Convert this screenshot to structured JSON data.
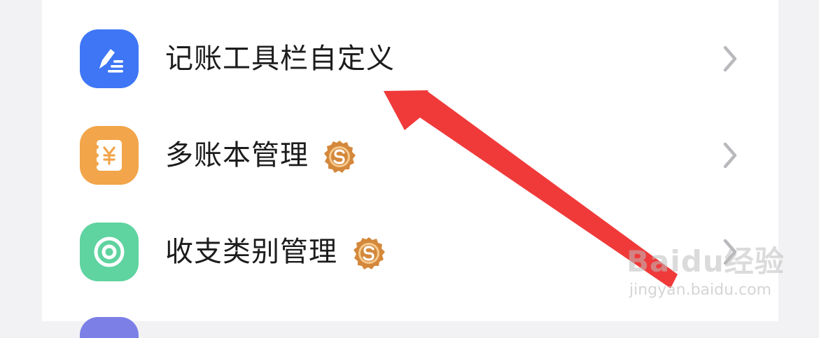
{
  "menu": {
    "items": [
      {
        "label": "记账工具栏自定义",
        "icon": "pen-list-icon",
        "color": "#3e76f5",
        "coin_badge": false
      },
      {
        "label": "多账本管理",
        "icon": "yuan-ledger-icon",
        "color": "#f2a54a",
        "coin_badge": true
      },
      {
        "label": "收支类别管理",
        "icon": "target-icon",
        "color": "#5fd3a0",
        "coin_badge": true
      }
    ],
    "chevron_icon": "chevron-right-icon",
    "badge_icon": "coin-badge-icon"
  },
  "colors": {
    "page_bg": "#f2f2f4",
    "card_bg": "#ffffff",
    "arrow": "#f03a3a",
    "badge": "#d4883b"
  },
  "watermark": {
    "logo": "Baidu经验",
    "url": "jingyan.baidu.com"
  }
}
